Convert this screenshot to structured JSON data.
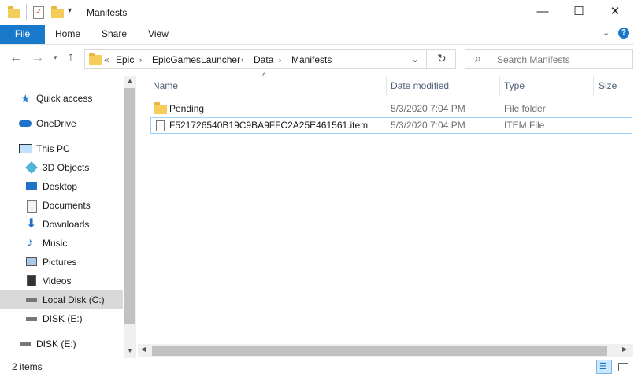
{
  "window": {
    "title": "Manifests"
  },
  "ribbon": {
    "tabs": [
      "File",
      "Home",
      "Share",
      "View"
    ]
  },
  "address": {
    "crumbs": [
      "Epic",
      "EpicGamesLauncher",
      "Data",
      "Manifests"
    ],
    "overflow": "«"
  },
  "search": {
    "placeholder": "Search Manifests"
  },
  "nav": {
    "items": [
      "Quick access",
      "OneDrive",
      "This PC",
      "3D Objects",
      "Desktop",
      "Documents",
      "Downloads",
      "Music",
      "Pictures",
      "Videos",
      "Local Disk (C:)",
      "DISK (E:)",
      "DISK (E:)"
    ]
  },
  "list": {
    "columns": [
      "Name",
      "Date modified",
      "Type",
      "Size"
    ],
    "rows": [
      {
        "name": "Pending",
        "date": "5/3/2020 7:04 PM",
        "type": "File folder",
        "icon": "folder-icon"
      },
      {
        "name": "F521726540B19C9BA9FFC2A25E461561.item",
        "date": "5/3/2020 7:04 PM",
        "type": "ITEM File",
        "icon": "file-icon"
      }
    ]
  },
  "status": {
    "count": "2 items"
  },
  "colors": {
    "accent": "#1979ca",
    "folder": "#f5cd5a",
    "selection_bg": "#cce8ff"
  }
}
